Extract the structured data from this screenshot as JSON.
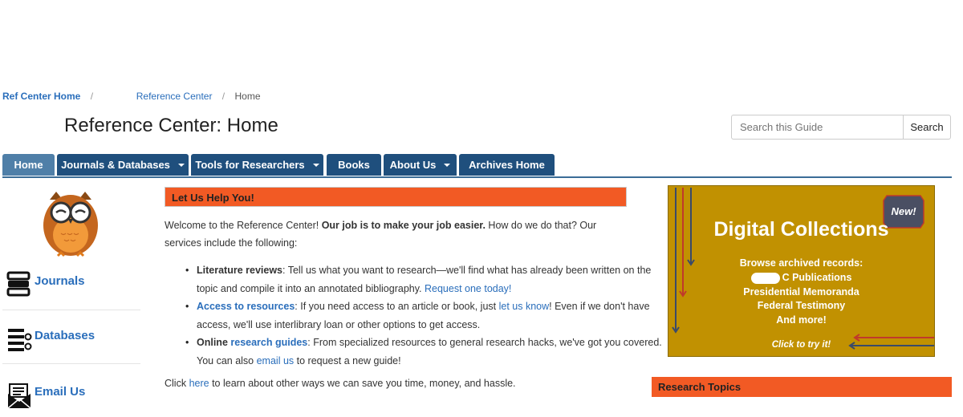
{
  "breadcrumb": {
    "home": "Ref Center Home",
    "center": "Reference Center",
    "current": "Home"
  },
  "page_title": "Reference Center: Home",
  "search": {
    "placeholder": "Search this Guide",
    "button": "Search"
  },
  "nav": {
    "tabs": [
      {
        "label": "Home",
        "active": true,
        "dropdown": false
      },
      {
        "label": "Journals & Databases",
        "active": false,
        "dropdown": true
      },
      {
        "label": "Tools for Researchers",
        "active": false,
        "dropdown": true
      },
      {
        "label": "Books",
        "active": false,
        "dropdown": false
      },
      {
        "label": "About Us",
        "active": false,
        "dropdown": true
      },
      {
        "label": "Archives Home",
        "active": false,
        "dropdown": false
      }
    ]
  },
  "sidebar": {
    "items": [
      {
        "label": "Journals",
        "icon": "journals-icon"
      },
      {
        "label": "Databases",
        "icon": "databases-icon"
      },
      {
        "label": "Email Us",
        "icon": "email-icon"
      }
    ]
  },
  "main": {
    "help_heading": "Let Us Help You!",
    "intro_a": "Welcome to the Reference Center! ",
    "intro_b": "Our job is to make your job easier.",
    "intro_c": " How do we do that? Our services include the following:",
    "bullet1": {
      "strong": "Literature reviews",
      "text": ": Tell us what you want to research—we'll find what has already been written on the topic and compile it into an annotated bibliography. ",
      "link": "Request one today!"
    },
    "bullet2": {
      "link": "Access to resources",
      "text_a": ": If you need access to an article or book, just ",
      "link2": "let us know",
      "text_b": "! Even if we don't have access, we'll use interlibrary loan or other options to get access."
    },
    "bullet3": {
      "strong": "Online ",
      "link": "research guides",
      "text_a": ": From specialized resources to general research hacks, we've got you covered. You can also ",
      "link2": "email us",
      "text_b": " to request a new guide!"
    },
    "click_a": "Click ",
    "click_link": "here",
    "click_b": " to learn about other ways we can save you time, money, and hassle."
  },
  "banner": {
    "badge": "New!",
    "title": "Digital Collections",
    "line1": "Browse archived records:",
    "line2": "C Publications",
    "line3": "Presidential Memoranda",
    "line4": "Federal Testimony",
    "line5": "And more!",
    "cta": "Click to try it!",
    "bg_color": "#c19101"
  },
  "research_topics_heading": "Research Topics",
  "colors": {
    "accent_orange": "#f25a24",
    "nav_blue": "#1f4f7d",
    "nav_active": "#4f7fa8",
    "link": "#2a6ebb"
  }
}
